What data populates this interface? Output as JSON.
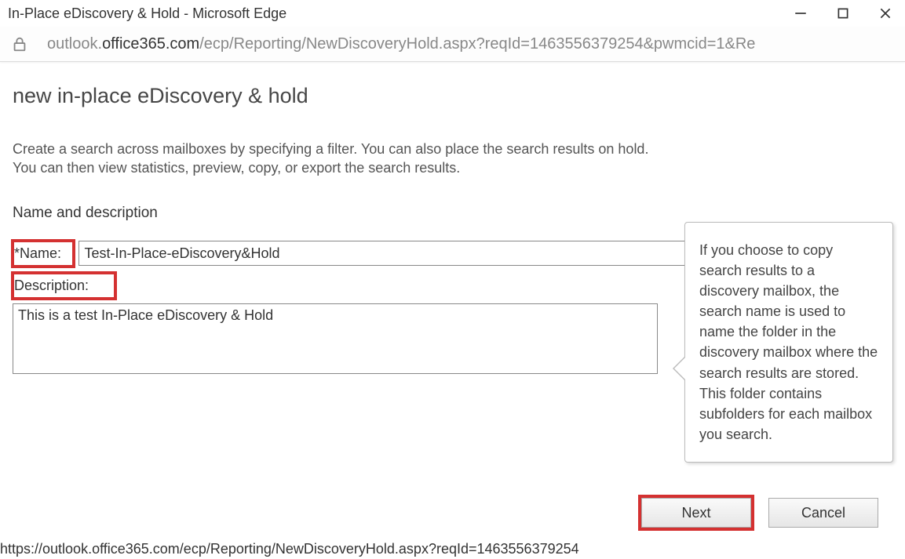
{
  "window": {
    "title": "In-Place eDiscovery & Hold - Microsoft Edge"
  },
  "addressBar": {
    "prefix": "outlook.",
    "domain": "office365.com",
    "path": "/ecp/Reporting/NewDiscoveryHold.aspx?reqId=1463556379254&pwmcid=1&Re"
  },
  "page": {
    "title": "new in-place eDiscovery & hold",
    "intro": "Create a search across mailboxes by specifying a filter. You can also place the search results on hold. You can then view statistics, preview, copy, or export the search results.",
    "sectionHeader": "Name and description",
    "nameLabel": "*Name:",
    "nameValue": "Test-In-Place-eDiscovery&Hold",
    "descriptionLabel": "Description:",
    "descriptionValue": "This is a test In-Place eDiscovery & Hold"
  },
  "tooltip": {
    "text": "If you choose to copy search results to a discovery mailbox, the search name is used to name the folder in the discovery mailbox where the search results are stored. This folder contains subfolders for each mailbox you search."
  },
  "buttons": {
    "next": "Next",
    "cancel": "Cancel"
  },
  "statusBar": {
    "text": "https://outlook.office365.com/ecp/Reporting/NewDiscoveryHold.aspx?reqId=1463556379254"
  }
}
